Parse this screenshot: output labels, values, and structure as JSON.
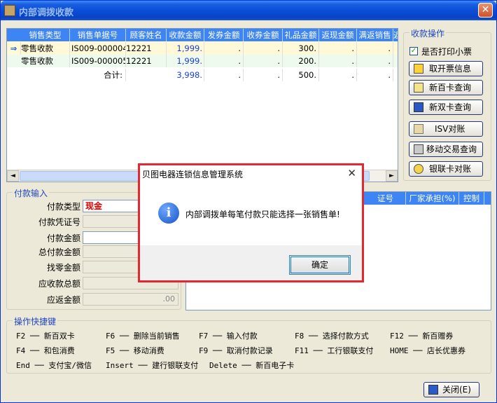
{
  "window": {
    "title": "内部调拨收款",
    "close_glyph": "✕"
  },
  "grid": {
    "columns": [
      "销售类型",
      "销售单据号",
      "顾客姓名",
      "收款金额",
      "发券金额",
      "收券金额",
      "礼品金额",
      "返现金额",
      "满返销售",
      "返"
    ],
    "rows": [
      {
        "type": "零售收款",
        "doc": "IS009-000004",
        "customer": "12221",
        "amount": "1,999.",
        "c5": ".",
        "c6": ".",
        "c7": "300.",
        "c8": ".",
        "c9": "."
      },
      {
        "type": "零售收款",
        "doc": "IS009-000005",
        "customer": "12221",
        "amount": "1,999.",
        "c5": ".",
        "c6": ".",
        "c7": "200.",
        "c8": ".",
        "c9": "."
      }
    ],
    "total": {
      "label": "合计:",
      "amount": "3,998.",
      "c5": ".",
      "c6": ".",
      "c7": "500.",
      "c8": ".",
      "c9": "."
    },
    "scroll_left": "◄",
    "scroll_right": "►"
  },
  "ops": {
    "caption": "收款操作",
    "print_receipt_label": "是否打印小票",
    "print_receipt_checked": true,
    "buttons": [
      {
        "label": "取开票信息",
        "icon": "ticket-icon"
      },
      {
        "label": "新百卡查询",
        "icon": "card-search-icon"
      },
      {
        "label": "新双卡查询",
        "icon": "dual-card-icon"
      },
      {
        "label": "ISV对账",
        "icon": "isv-icon"
      },
      {
        "label": "移动交易查询",
        "icon": "mobile-icon"
      },
      {
        "label": "银联卡对账",
        "icon": "unionpay-icon"
      }
    ]
  },
  "payment": {
    "caption": "付款输入",
    "fields": [
      {
        "label": "付款类型",
        "value": "现金"
      },
      {
        "label": "付款凭证号",
        "value": ""
      },
      {
        "label": "付款金额",
        "value": ""
      },
      {
        "label": "总付款金额",
        "value": ""
      },
      {
        "label": "找零金额",
        "value": ""
      },
      {
        "label": "应收款总额",
        "value": ""
      },
      {
        "label": "应返金额",
        "value": ".00"
      }
    ]
  },
  "right_grid": {
    "columns": [
      "证号",
      "厂家承担(%)",
      "控制"
    ]
  },
  "shortcuts": {
    "caption": "操作快捷键",
    "rows": [
      [
        "F2 ── 新百双卡",
        "F6 ── 删除当前销售",
        "F7 ── 输入付款",
        "F8 ── 选择付款方式",
        "F12 ── 新百赠券"
      ],
      [
        "F4 ── 和包消费",
        "F5 ── 移动消费",
        "F9 ── 取消付款记录",
        "F11 ── 工行银联支付",
        "HOME ── 店长优惠券"
      ],
      [
        "End ── 支付宝/微信",
        "Insert ── 建行银联支付",
        "Delete ── 新百电子卡"
      ]
    ]
  },
  "close_button": {
    "label": "关闭(E)"
  },
  "dialog": {
    "title": "贝图电器连锁信息管理系统",
    "message": "内部调拨单每笔付款只能选择一张销售单!",
    "ok_label": "确定",
    "close_glyph": "✕",
    "info_glyph": "i"
  }
}
